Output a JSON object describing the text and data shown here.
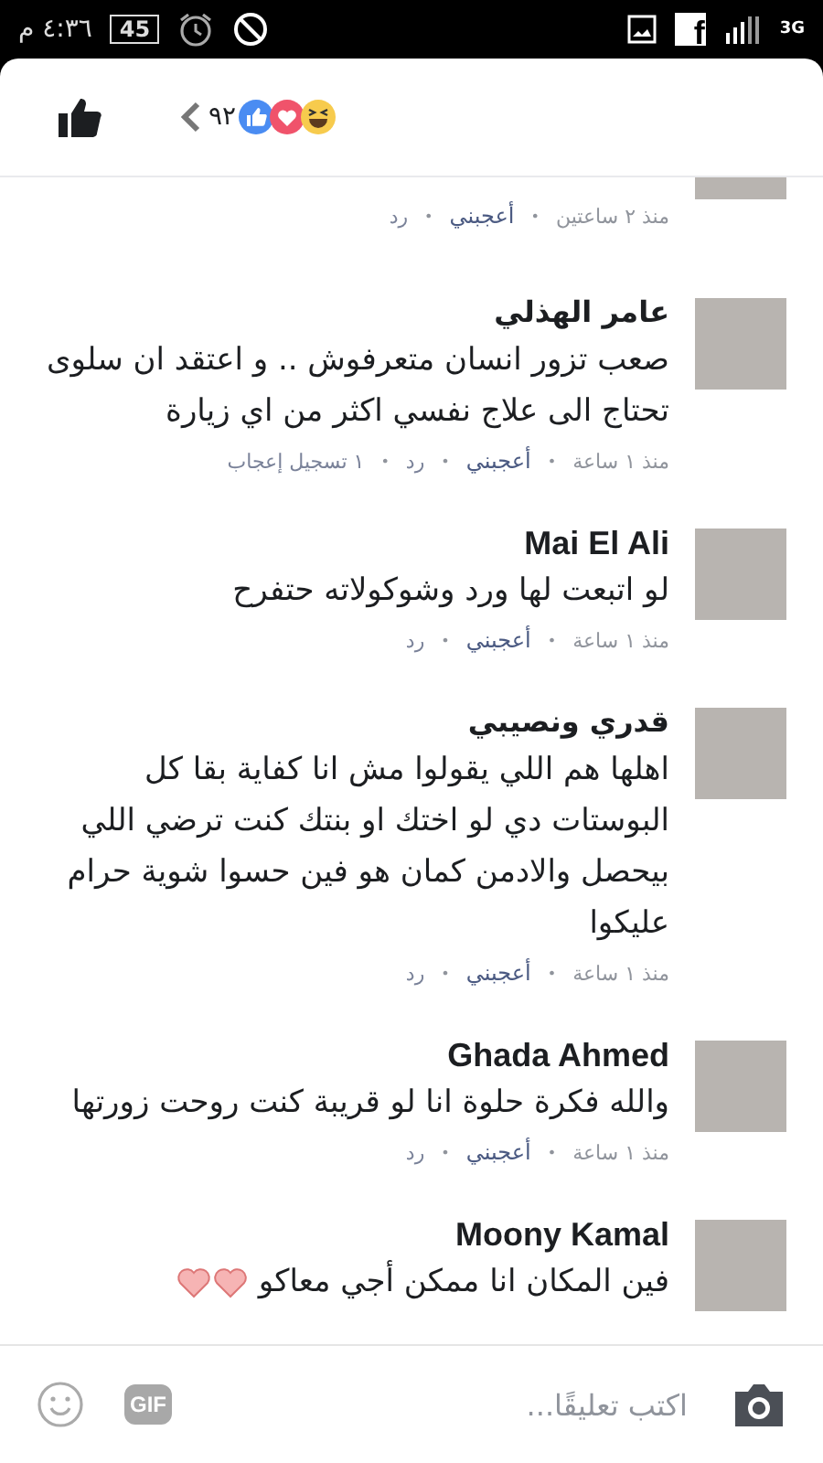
{
  "status_bar": {
    "time": "٤:٣٦ م",
    "battery": "45",
    "app_glyph": "f",
    "network": "3G"
  },
  "header": {
    "reactions": [
      {
        "kind": "like"
      },
      {
        "kind": "love"
      },
      {
        "kind": "haha"
      }
    ],
    "reaction_count": "٩٢"
  },
  "comments": [
    {
      "time": "منذ ٢ ساعتين",
      "actions": [
        "أعجبني",
        "رد"
      ]
    },
    {
      "name": "عامر الهذلي",
      "body": "صعب تزور انسان متعرفوش .. و اعتقد ان سلوى تحتاج الى علاج نفسي اكثر من اي زيارة",
      "time": "منذ ١ ساعة",
      "actions": [
        "أعجبني",
        "رد"
      ],
      "likes": "١ تسجيل إعجاب"
    },
    {
      "name": "Mai El Ali",
      "body": "لو اتبعت لها ورد وشوكولاته حتفرح",
      "time": "منذ ١ ساعة",
      "actions": [
        "أعجبني",
        "رد"
      ]
    },
    {
      "name": "قدري ونصيبي",
      "body": "اهلها هم اللي يقولوا مش انا كفاية بقا كل البوستات دي لو اختك او بنتك كنت ترضي اللي بيحصل والادمن كمان هو فين حسوا شوية حرام عليكوا",
      "time": "منذ ١ ساعة",
      "actions": [
        "أعجبني",
        "رد"
      ]
    },
    {
      "name": "Ghada Ahmed",
      "body": "والله فكرة حلوة انا لو قريبة كنت روحت زورتها",
      "time": "منذ ١ ساعة",
      "actions": [
        "أعجبني",
        "رد"
      ]
    },
    {
      "name": "Moony Kamal",
      "body": "فين المكان انا ممكن أجي معاكو",
      "emoji": [
        {
          "kind": "heart"
        },
        {
          "kind": "heart"
        }
      ]
    }
  ],
  "meta_separator": "•",
  "composer": {
    "placeholder": "اكتب تعليقًا...",
    "gif_label": "GIF"
  }
}
